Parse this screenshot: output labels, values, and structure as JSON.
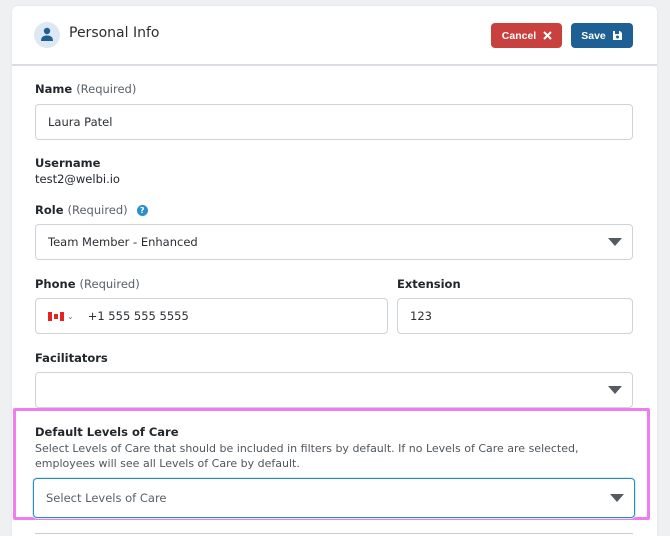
{
  "header": {
    "title": "Personal Info",
    "cancel_label": "Cancel",
    "save_label": "Save"
  },
  "form": {
    "name": {
      "label": "Name",
      "required": "(Required)",
      "value": "Laura Patel"
    },
    "username": {
      "label": "Username",
      "value": "test2@welbi.io"
    },
    "role": {
      "label": "Role",
      "required": "(Required)",
      "help_icon": "?",
      "value": "Team Member - Enhanced"
    },
    "phone": {
      "label": "Phone",
      "required": "(Required)",
      "country": "CA",
      "value": "+1 555 555 5555"
    },
    "extension": {
      "label": "Extension",
      "value": "123"
    },
    "facilitators": {
      "label": "Facilitators",
      "value": ""
    },
    "levels_of_care": {
      "label": "Default Levels of Care",
      "description": "Select Levels of Care that should be included in filters by default. If no Levels of Care are selected, employees will see all Levels of Care by default.",
      "placeholder": "Select Levels of Care"
    }
  },
  "colors": {
    "cancel": "#c8413f",
    "save": "#1e5f94",
    "highlight": "#f07df0",
    "focus": "#2a8fb8"
  },
  "icons": {
    "avatar": "user-icon",
    "cancel": "close-icon",
    "save": "floppy-disk-icon",
    "help": "help-icon",
    "flag": "canada-flag-icon",
    "dropdown": "caret-down-icon"
  }
}
